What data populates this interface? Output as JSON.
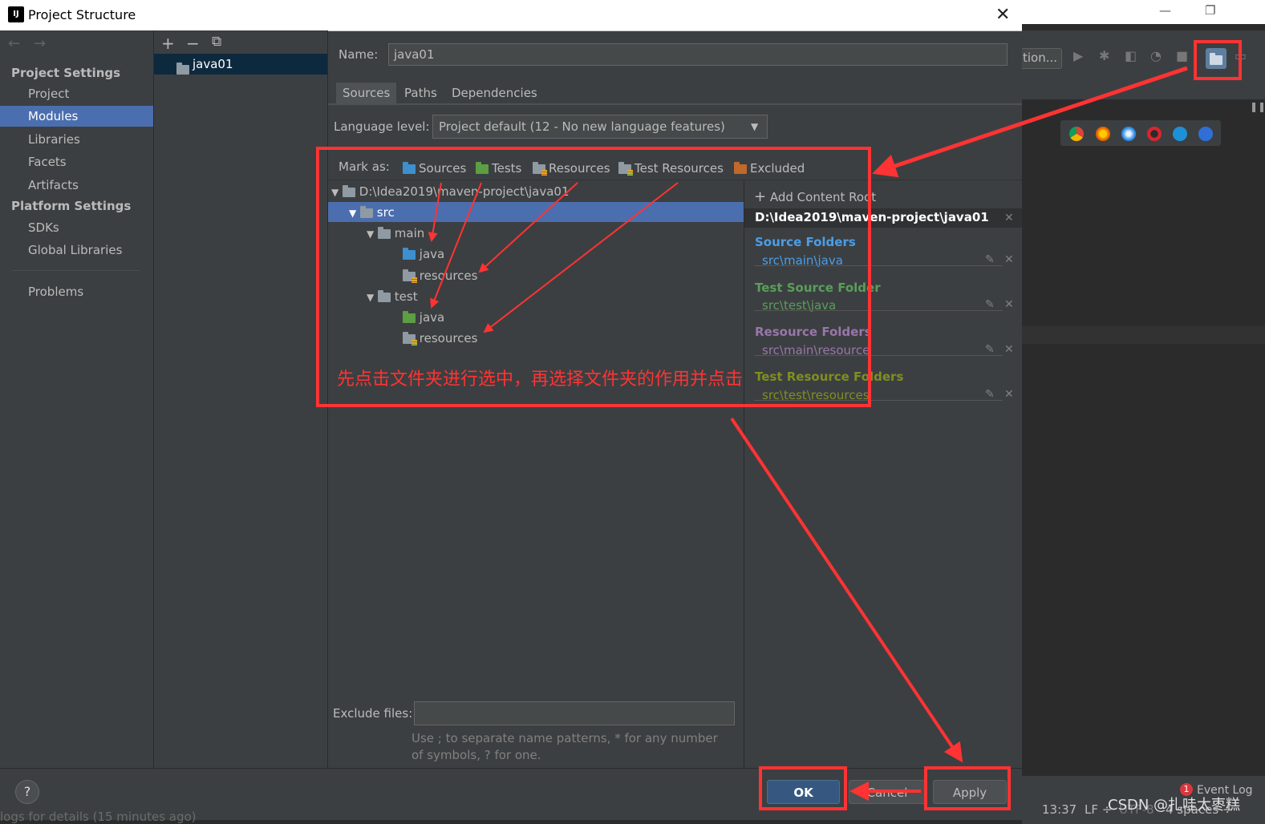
{
  "dialog": {
    "title": "Project Structure",
    "app_icon": "IJ",
    "close": "✕"
  },
  "sidebar": {
    "back": "←",
    "forward": "→",
    "project_settings_header": "Project Settings",
    "project_settings_items": [
      "Project",
      "Modules",
      "Libraries",
      "Facets",
      "Artifacts"
    ],
    "platform_settings_header": "Platform Settings",
    "platform_settings_items": [
      "SDKs",
      "Global Libraries"
    ],
    "problems": "Problems",
    "selected": "Modules"
  },
  "modules": {
    "add": "+",
    "remove": "−",
    "copy": "⧉",
    "items": [
      "java01"
    ]
  },
  "module": {
    "name_label": "Name:",
    "name_value": "java01",
    "tabs": [
      "Sources",
      "Paths",
      "Dependencies"
    ],
    "active_tab": "Sources",
    "language_level_label": "Language level:",
    "language_level_main": "Project default",
    "language_level_detail": " (12 - No new language features)",
    "mark_as_label": "Mark as:",
    "mark_buttons": [
      "Sources",
      "Tests",
      "Resources",
      "Test Resources",
      "Excluded"
    ]
  },
  "tree": {
    "root": "D:\\Idea2019\\maven-project\\java01",
    "src": "src",
    "main": "main",
    "main_java": "java",
    "main_resources": "resources",
    "test": "test",
    "test_java": "java",
    "test_resources": "resources"
  },
  "content_roots": {
    "add_label": "Add Content Root",
    "root_path": "D:\\Idea2019\\maven-project\\java01",
    "groups": [
      {
        "title": "Source Folders",
        "path": "src\\main\\java",
        "color": "#4a9ee8"
      },
      {
        "title": "Test Source Folder",
        "path": "src\\test\\java",
        "color": "#5a9e5a"
      },
      {
        "title": "Resource Folders",
        "path": "src\\main\\resource",
        "color": "#9876aa"
      },
      {
        "title": "Test Resource Folders",
        "path": "src\\test\\resources",
        "color": "#7f8f1f"
      }
    ]
  },
  "exclude": {
    "label": "Exclude files:",
    "hint": "Use ; to separate name patterns, * for any number of symbols, ? for one."
  },
  "buttons": {
    "help": "?",
    "ok": "OK",
    "cancel": "Cancel",
    "apply": "Apply"
  },
  "annotation": {
    "text": "先点击文件夹进行选中，再选择文件夹的作用并点击"
  },
  "ide": {
    "config_text": "tion...",
    "win_min": "—",
    "win_max": "❐",
    "status_time": "13:37",
    "status_lf": "LF ÷",
    "status_encoding": "UTF-8",
    "status_indent": "4 spaces ÷",
    "event_log": "Event Log",
    "event_count": "1",
    "bottom_log": "logs for details (15 minutes ago)",
    "watermark": "CSDN @扎哇太枣糕"
  }
}
